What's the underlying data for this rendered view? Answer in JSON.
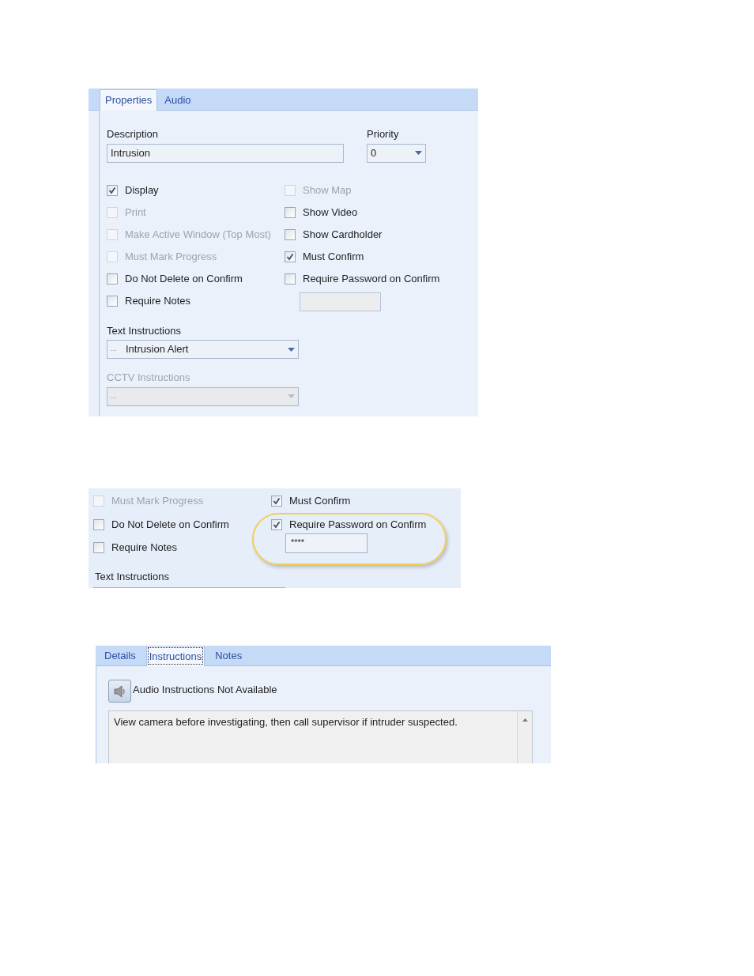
{
  "properties_dialog": {
    "tabs": [
      {
        "label": "Properties",
        "selected": true
      },
      {
        "label": "Audio",
        "selected": false
      }
    ],
    "description": {
      "label": "Description",
      "value": "Intrusion"
    },
    "priority": {
      "label": "Priority",
      "value": "0"
    },
    "left_options": [
      {
        "label": "Display",
        "checked": true,
        "disabled": false
      },
      {
        "label": "Print",
        "checked": false,
        "disabled": true
      },
      {
        "label": "Make Active Window (Top Most)",
        "checked": false,
        "disabled": true
      },
      {
        "label": "Must Mark Progress",
        "checked": false,
        "disabled": true
      },
      {
        "label": "Do Not Delete on Confirm",
        "checked": false,
        "disabled": false
      },
      {
        "label": "Require Notes",
        "checked": false,
        "disabled": false
      }
    ],
    "right_options": [
      {
        "label": "Show Map",
        "checked": false,
        "disabled": true
      },
      {
        "label": "Show Video",
        "checked": false,
        "disabled": false
      },
      {
        "label": "Show Cardholder",
        "checked": false,
        "disabled": false
      },
      {
        "label": "Must Confirm",
        "checked": true,
        "disabled": false
      },
      {
        "label": "Require Password on Confirm",
        "checked": false,
        "disabled": false
      }
    ],
    "password": {
      "disabled": true
    },
    "text_instructions": {
      "label": "Text Instructions",
      "prefix": "...",
      "value": "Intrusion Alert",
      "disabled": false
    },
    "cctv_instructions": {
      "label": "CCTV Instructions",
      "prefix": "...",
      "disabled": true
    }
  },
  "password_detail": {
    "left_options": [
      {
        "label": "Must Mark Progress",
        "checked": false,
        "disabled": true
      },
      {
        "label": "Do Not Delete on Confirm",
        "checked": false,
        "disabled": false
      },
      {
        "label": "Require Notes",
        "checked": false,
        "disabled": false
      }
    ],
    "right_options": [
      {
        "label": "Must Confirm",
        "checked": true,
        "disabled": false
      },
      {
        "label": "Require Password on Confirm",
        "checked": true,
        "disabled": false
      }
    ],
    "password": {
      "value": "****"
    },
    "text_instructions": {
      "label": "Text Instructions"
    }
  },
  "instructions_panel": {
    "tabs": [
      {
        "label": "Details",
        "selected": false
      },
      {
        "label": "Instructions",
        "selected": true
      },
      {
        "label": "Notes",
        "selected": false
      }
    ],
    "audio_status": "Audio Instructions Not Available",
    "instructions_text": "View camera before investigating, then call supervisor if intruder suspected."
  }
}
